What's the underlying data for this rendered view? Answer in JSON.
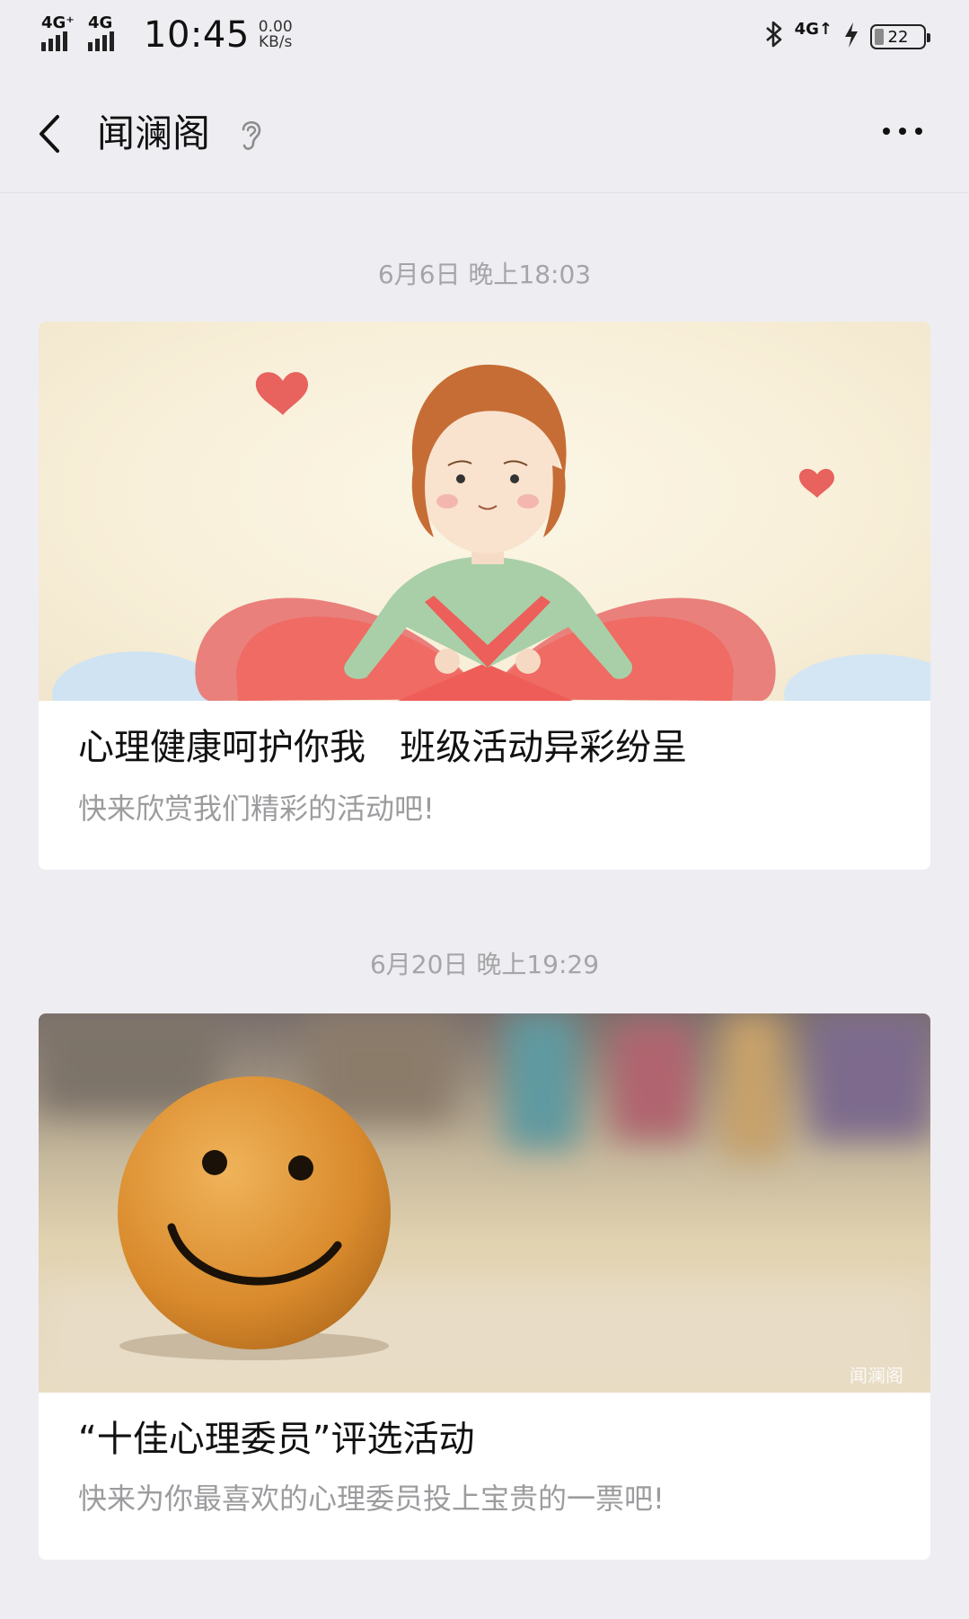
{
  "status_bar": {
    "sim1": "4G⁺",
    "sim2": "4G",
    "time": "10:45",
    "speed_value": "0.00",
    "speed_unit": "KB/s",
    "network": "4G↑",
    "battery": "22"
  },
  "nav": {
    "title": "闻澜阁"
  },
  "messages": [
    {
      "timestamp": "6月6日 晚上18:03",
      "title": "心理健康呵护你我   班级活动异彩纷呈",
      "subtitle": "快来欣赏我们精彩的活动吧!"
    },
    {
      "timestamp": "6月20日 晚上19:29",
      "title": "“十佳心理委员”评选活动",
      "subtitle": "快来为你最喜欢的心理委员投上宝贵的一票吧!",
      "watermark": "闻澜阁"
    }
  ],
  "colors": {
    "background": "#eeedf1",
    "card": "#ffffff",
    "timestamp": "#a5a5a8",
    "subtitle": "#9c9c9f"
  }
}
